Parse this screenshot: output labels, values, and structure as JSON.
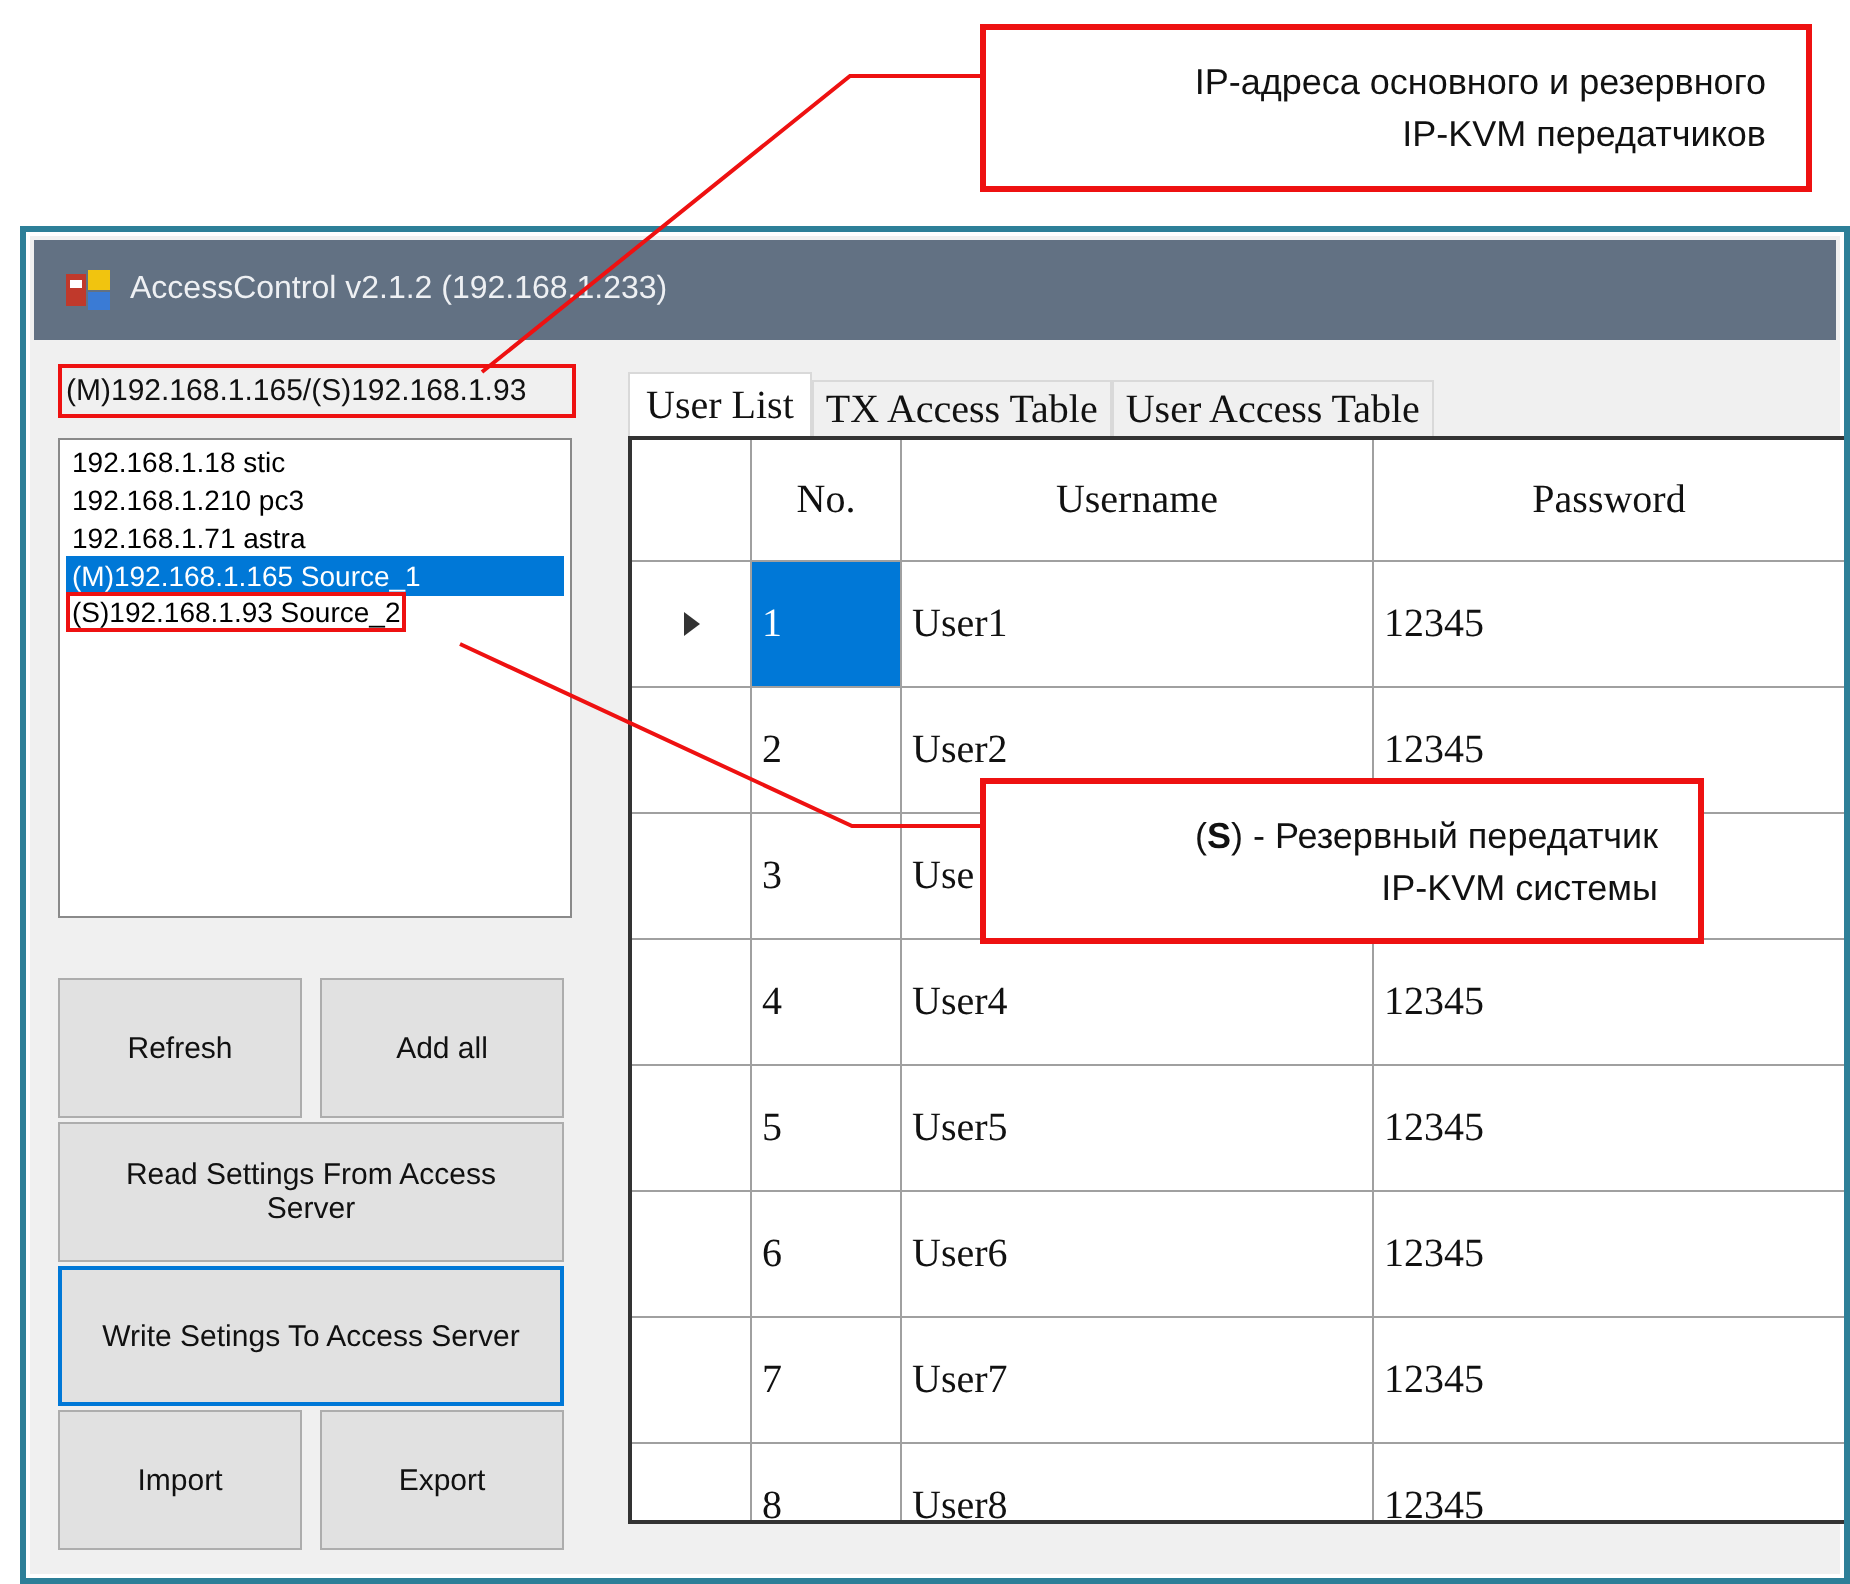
{
  "callouts": [
    {
      "text": "IP-адреса основного и резервного IP-KVM передатчиков"
    },
    {
      "text": "(**S**) - Резервный передатчик IP-KVM системы"
    }
  ],
  "window": {
    "title": "AccessControl v2.1.2 (192.168.1.233)"
  },
  "server_label": {
    "text": "(M)192.168.1.165/(S)192.168.1.93",
    "highlighted": true
  },
  "source_list": [
    {
      "text": "192.168.1.18 stic",
      "selected": false,
      "highlighted": false
    },
    {
      "text": "192.168.1.210 pc3",
      "selected": false,
      "highlighted": false
    },
    {
      "text": "192.168.1.71 astra",
      "selected": false,
      "highlighted": false
    },
    {
      "text": "(M)192.168.1.165 Source_1",
      "selected": true,
      "highlighted": false
    },
    {
      "text": "(S)192.168.1.93 Source_2",
      "selected": false,
      "highlighted": true
    }
  ],
  "buttons": [
    {
      "label": "Refresh",
      "kind": "half",
      "focused": false
    },
    {
      "label": "Add all",
      "kind": "half",
      "focused": false
    },
    {
      "label": "Read Settings From Access Server",
      "kind": "wide",
      "focused": false
    },
    {
      "label": "Write Setings To Access Server",
      "kind": "wide",
      "focused": true
    },
    {
      "label": "Import",
      "kind": "half",
      "focused": false
    },
    {
      "label": "Export",
      "kind": "half",
      "focused": false
    }
  ],
  "tabs": [
    {
      "label": "User List",
      "selected": true
    },
    {
      "label": "TX Access Table",
      "selected": false
    },
    {
      "label": "User Access Table",
      "selected": false
    }
  ],
  "table": {
    "columns": [
      "No.",
      "Username",
      "Password"
    ],
    "rows": [
      {
        "no": "1",
        "username": "User1",
        "password": "12345",
        "selected": true
      },
      {
        "no": "2",
        "username": "User2",
        "password": "12345",
        "selected": false
      },
      {
        "no": "3",
        "username": "Use",
        "selected": false
      },
      {
        "no": "4",
        "username": "User4",
        "password": "12345",
        "selected": false
      },
      {
        "no": "5",
        "username": "User5",
        "password": "12345",
        "selected": false
      },
      {
        "no": "6",
        "username": "User6",
        "password": "12345",
        "selected": false
      },
      {
        "no": "7",
        "username": "User7",
        "password": "12345",
        "selected": false
      },
      {
        "no": "8",
        "username": "User8",
        "password": "12345",
        "selected": false
      }
    ]
  }
}
